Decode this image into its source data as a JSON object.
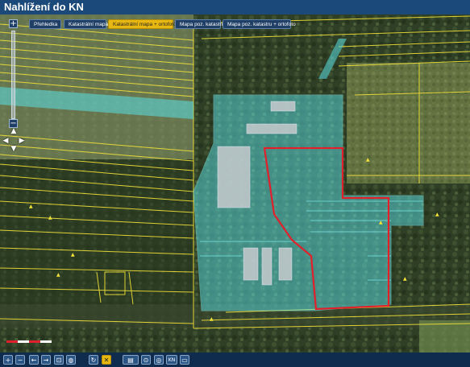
{
  "app": {
    "title": "Nahlížení do KN"
  },
  "tabs": [
    {
      "label": "Přehledka",
      "active": false
    },
    {
      "label": "Katastrální mapa",
      "active": false
    },
    {
      "label": "Katastrální mapa + ortofoto",
      "active": true
    },
    {
      "label": "Mapa poz. katastru",
      "active": false
    },
    {
      "label": "Mapa poz. katastru + ortofoto",
      "active": false
    }
  ],
  "controls": {
    "zoom_in": "+",
    "zoom_out": "−",
    "pan_up": "▲",
    "pan_down": "▼",
    "pan_left": "◀",
    "pan_right": "▶"
  },
  "footer": {
    "buttons": [
      {
        "icon": "zoom-in-icon",
        "glyph": "+"
      },
      {
        "icon": "zoom-out-icon",
        "glyph": "−"
      },
      {
        "icon": "back-arrow-icon",
        "glyph": "←"
      },
      {
        "icon": "forward-arrow-icon",
        "glyph": "→"
      },
      {
        "icon": "measure-icon",
        "glyph": "⊡"
      },
      {
        "icon": "globe-icon",
        "glyph": "◍"
      },
      {
        "icon": "refresh-icon",
        "glyph": "↻"
      },
      {
        "icon": "close-icon",
        "glyph": "✕"
      },
      {
        "icon": "layers-icon",
        "glyph": "▤"
      },
      {
        "icon": "pin-icon",
        "glyph": "⊙"
      },
      {
        "icon": "locate-icon",
        "glyph": "◎"
      },
      {
        "icon": "kn-icon",
        "glyph": "KN"
      },
      {
        "icon": "comment-icon",
        "glyph": "▭"
      }
    ],
    "status": ""
  },
  "colors": {
    "parcel_lines": "#f2e23a",
    "highlight": "#5be0e6",
    "selected_parcel": "#e0202a",
    "header": "#1b4a7a",
    "active_tab": "#e8b812"
  }
}
